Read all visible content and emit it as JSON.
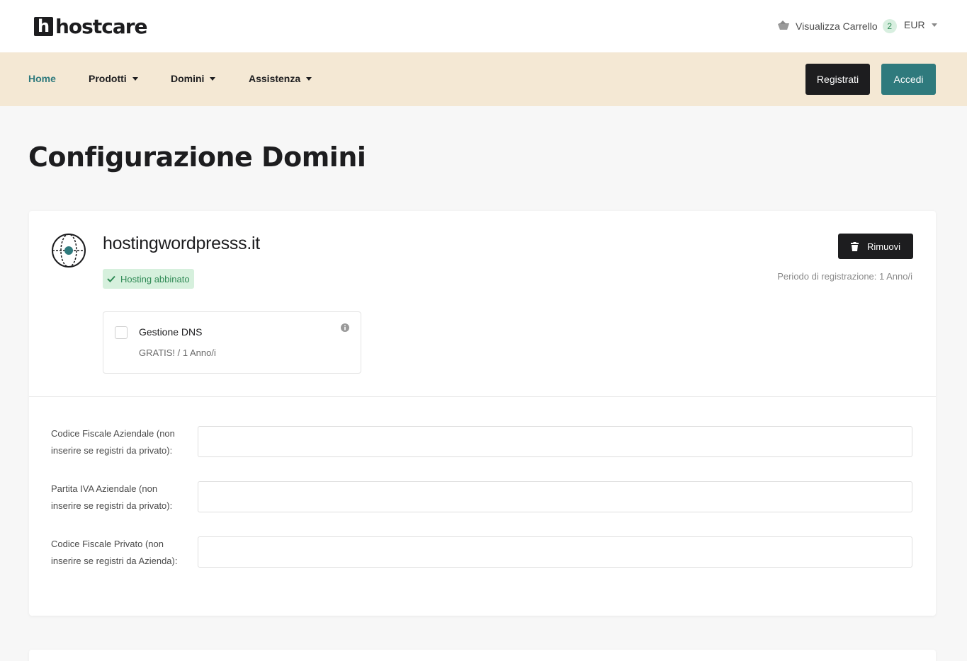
{
  "header": {
    "logo_mark": "h",
    "logo_text": "hostcare",
    "cart_label": "Visualizza Carrello",
    "cart_count": "2",
    "currency": "EUR"
  },
  "nav": {
    "items": [
      {
        "label": "Home",
        "active": true
      },
      {
        "label": "Prodotti",
        "dropdown": true
      },
      {
        "label": "Domini",
        "dropdown": true
      },
      {
        "label": "Assistenza",
        "dropdown": true
      }
    ],
    "register_label": "Registrati",
    "login_label": "Accedi"
  },
  "page": {
    "title": "Configurazione Domini"
  },
  "domain": {
    "name": "hostingwordpresss.it",
    "badge": "Hosting abbinato",
    "remove_label": "Rimuovi",
    "registration_period": "Periodo di registrazione: 1 Anno/i",
    "addon": {
      "title": "Gestione DNS",
      "price": "GRATIS! / 1 Anno/i",
      "checked": false
    }
  },
  "fields": [
    {
      "label": "Codice Fiscale Aziendale (non inserire se registri da privato):",
      "value": ""
    },
    {
      "label": "Partita IVA Aziendale (non inserire se registri da privato):",
      "value": ""
    },
    {
      "label": "Codice Fiscale Privato (non inserire se registri da Azienda):",
      "value": ""
    }
  ],
  "colors": {
    "brand_dark": "#1d1d1f",
    "accent_teal": "#2f7a7d",
    "nav_bg": "#f4e8d4",
    "success_bg": "#d6f0dd",
    "success_text": "#2f8a55"
  },
  "icons": [
    "cart-icon",
    "globe-icon",
    "check-icon",
    "trash-icon",
    "info-icon",
    "chevron-down-icon"
  ]
}
